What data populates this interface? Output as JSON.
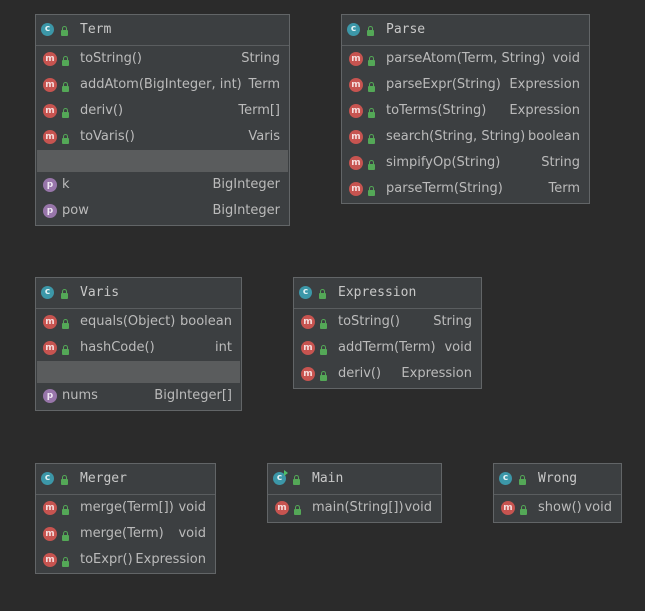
{
  "classes": {
    "term": {
      "name": "Term",
      "methods": [
        {
          "name": "toString()",
          "type": "String"
        },
        {
          "name": "addAtom(BigInteger, int)",
          "type": "Term"
        },
        {
          "name": "deriv()",
          "type": "Term[]"
        },
        {
          "name": "toVaris()",
          "type": "Varis"
        }
      ],
      "fields": [
        {
          "name": "k",
          "type": "BigInteger"
        },
        {
          "name": "pow",
          "type": "BigInteger"
        }
      ]
    },
    "parse": {
      "name": "Parse",
      "methods": [
        {
          "name": "parseAtom(Term, String)",
          "type": "void"
        },
        {
          "name": "parseExpr(String)",
          "type": "Expression"
        },
        {
          "name": "toTerms(String)",
          "type": "Expression"
        },
        {
          "name": "search(String, String)",
          "type": "boolean"
        },
        {
          "name": "simpifyOp(String)",
          "type": "String"
        },
        {
          "name": "parseTerm(String)",
          "type": "Term"
        }
      ]
    },
    "varis": {
      "name": "Varis",
      "methods": [
        {
          "name": "equals(Object)",
          "type": "boolean"
        },
        {
          "name": "hashCode()",
          "type": "int"
        }
      ],
      "fields": [
        {
          "name": "nums",
          "type": "BigInteger[]"
        }
      ]
    },
    "expression": {
      "name": "Expression",
      "methods": [
        {
          "name": "toString()",
          "type": "String"
        },
        {
          "name": "addTerm(Term)",
          "type": "void"
        },
        {
          "name": "deriv()",
          "type": "Expression"
        }
      ]
    },
    "merger": {
      "name": "Merger",
      "methods": [
        {
          "name": "merge(Term[])",
          "type": "void"
        },
        {
          "name": "merge(Term)",
          "type": "void"
        },
        {
          "name": "toExpr()",
          "type": "Expression"
        }
      ]
    },
    "main": {
      "name": "Main",
      "methods": [
        {
          "name": "main(String[])",
          "type": "void"
        }
      ]
    },
    "wrong": {
      "name": "Wrong",
      "methods": [
        {
          "name": "show()",
          "type": "void"
        }
      ]
    }
  },
  "icons": {
    "class_letter": "c",
    "method_letter": "m",
    "field_letter": "p"
  },
  "colors": {
    "background": "#2b2b2b",
    "box": "#3c3f41",
    "class_icon": "#3c97a8",
    "method_icon": "#c75450",
    "field_icon": "#9876aa",
    "lock": "#54a857"
  }
}
